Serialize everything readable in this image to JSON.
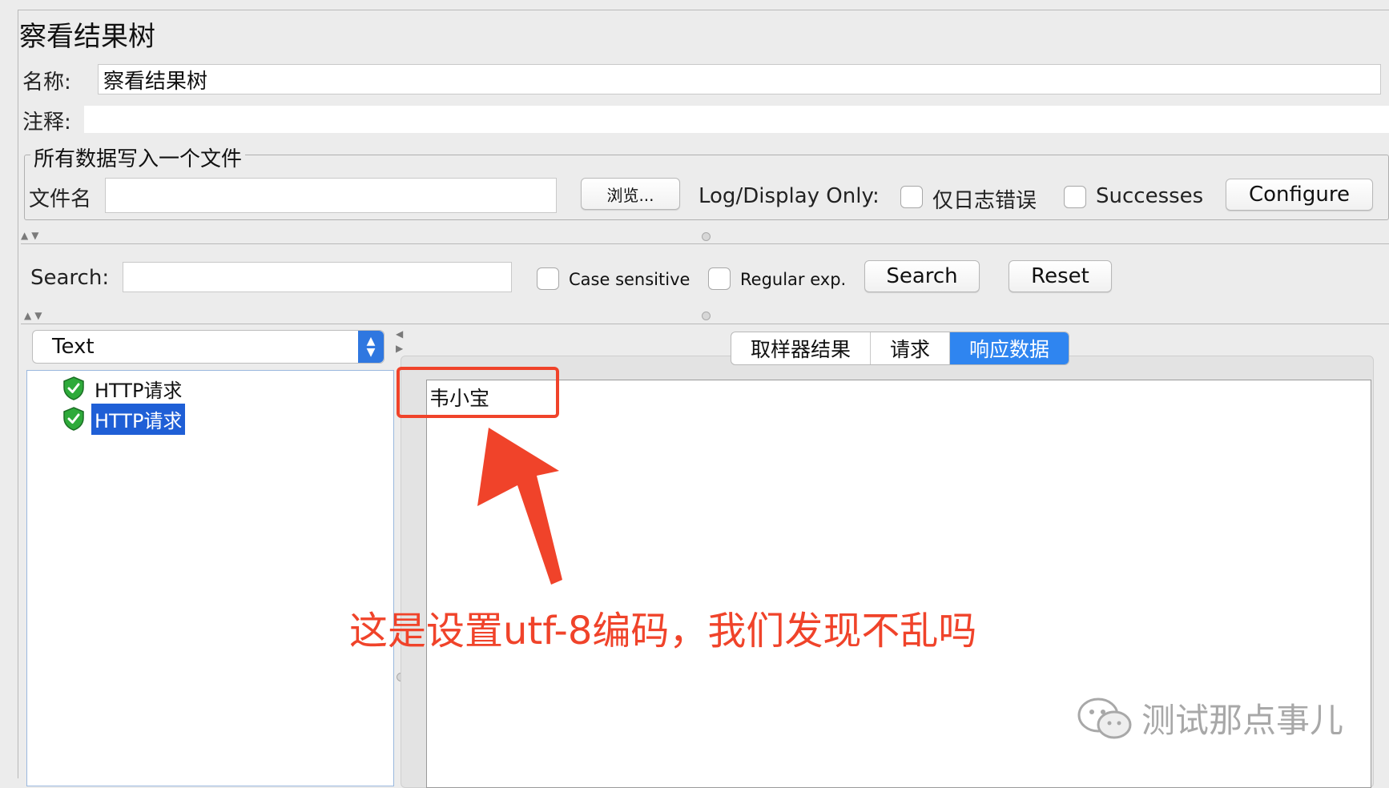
{
  "panel": {
    "title": "察看结果树"
  },
  "name_row": {
    "label": "名称:",
    "value": "察看结果树"
  },
  "comment_row": {
    "label": "注释:",
    "value": ""
  },
  "file_group": {
    "title": "所有数据写入一个文件",
    "filename_label": "文件名",
    "filename_value": "",
    "browse_label": "浏览...",
    "log_display_label": "Log/Display Only:",
    "errors_label": "仅日志错误",
    "successes_label": "Successes",
    "configure_label": "Configure"
  },
  "search_bar": {
    "label": "Search:",
    "value": "",
    "case_sensitive_label": "Case sensitive",
    "regex_label": "Regular exp.",
    "search_button": "Search",
    "reset_button": "Reset"
  },
  "renderer": {
    "selected": "Text"
  },
  "tree": {
    "items": [
      "HTTP请求",
      "HTTP请求"
    ],
    "selected_index": 1
  },
  "tabs": [
    {
      "label": "取样器结果",
      "active": false
    },
    {
      "label": "请求",
      "active": false
    },
    {
      "label": "响应数据",
      "active": true
    }
  ],
  "response": {
    "content": "韦小宝"
  },
  "annotation": {
    "text": "这是设置utf-8编码，我们发现不乱吗",
    "color": "#f0432a"
  },
  "watermark": {
    "text": "测试那点事儿"
  },
  "colors": {
    "accent": "#2f85f0",
    "annotation_red": "#f0432a",
    "success_green": "#2eaa3a"
  }
}
